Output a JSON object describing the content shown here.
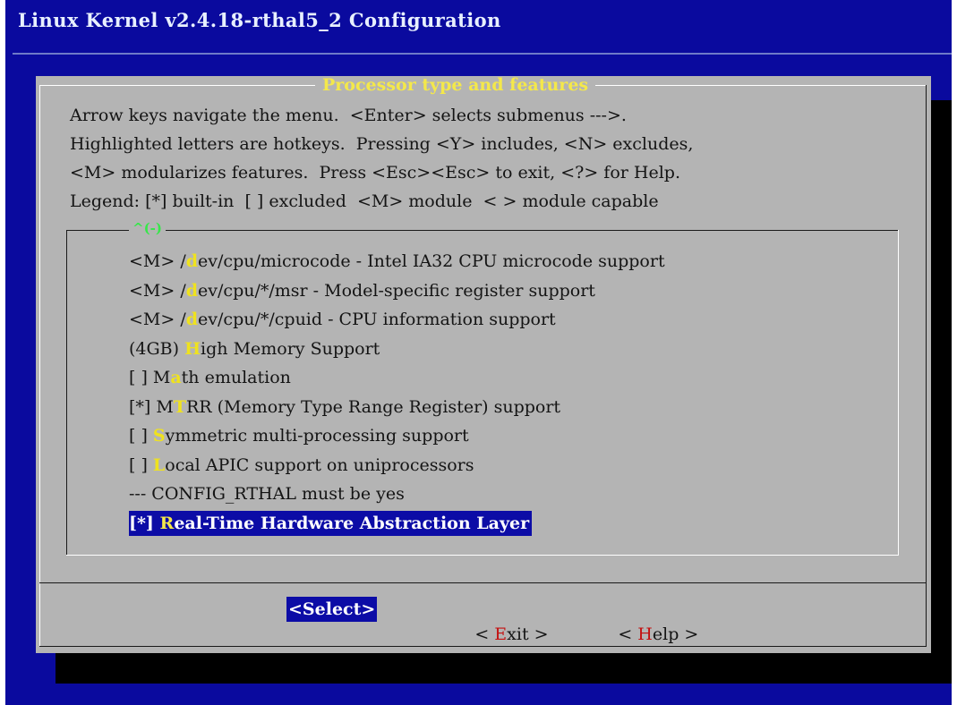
{
  "app": {
    "backtitle": "Linux Kernel v2.4.18-rthal5_2 Configuration"
  },
  "dialog": {
    "title": "Processor type and features",
    "help_lines": [
      "Arrow keys navigate the menu.  <Enter> selects submenus --->.",
      "Highlighted letters are hotkeys.  Pressing <Y> includes, <N> excludes,",
      "<M> modularizes features.  Press <Esc><Esc> to exit, <?> for Help.",
      "Legend: [*] built-in  [ ] excluded  <M> module  < > module capable"
    ],
    "scroll_indicator": "^(-)"
  },
  "menu": {
    "items": [
      {
        "pre": "<M> /",
        "hotkey": "d",
        "post": "ev/cpu/microcode - Intel IA32 CPU microcode support"
      },
      {
        "pre": "<M> /",
        "hotkey": "d",
        "post": "ev/cpu/*/msr - Model-specific register support"
      },
      {
        "pre": "<M> /",
        "hotkey": "d",
        "post": "ev/cpu/*/cpuid - CPU information support"
      },
      {
        "pre": "(4GB) ",
        "hotkey": "H",
        "post": "igh Memory Support"
      },
      {
        "pre": "[ ] M",
        "hotkey": "a",
        "post": "th emulation"
      },
      {
        "pre": "[*] M",
        "hotkey": "T",
        "post": "RR (Memory Type Range Register) support"
      },
      {
        "pre": "[ ] ",
        "hotkey": "S",
        "post": "ymmetric multi-processing support"
      },
      {
        "pre": "[ ] ",
        "hotkey": "L",
        "post": "ocal APIC support on uniprocessors"
      },
      {
        "pre": "--- CONFIG_RTHAL must be yes",
        "hotkey": "",
        "post": ""
      },
      {
        "pre": "[*] ",
        "hotkey": "R",
        "post": "eal-Time Hardware Abstraction Layer"
      }
    ],
    "selected_index": 9
  },
  "buttons": {
    "select": "<Select>",
    "exit": {
      "pre": "< ",
      "hotkey": "E",
      "post": "xit >"
    },
    "help": {
      "pre": "< ",
      "hotkey": "H",
      "post": "elp >"
    }
  },
  "colors": {
    "screen_bg": "#0a0a9e",
    "dialog_bg": "#b4b4b4",
    "title_yellow": "#f4e84a",
    "hotkey_yellow": "#efe21e",
    "hotkey_red": "#c41010",
    "scroll_green": "#37e64a",
    "selection_blue": "#0c0ca6"
  }
}
